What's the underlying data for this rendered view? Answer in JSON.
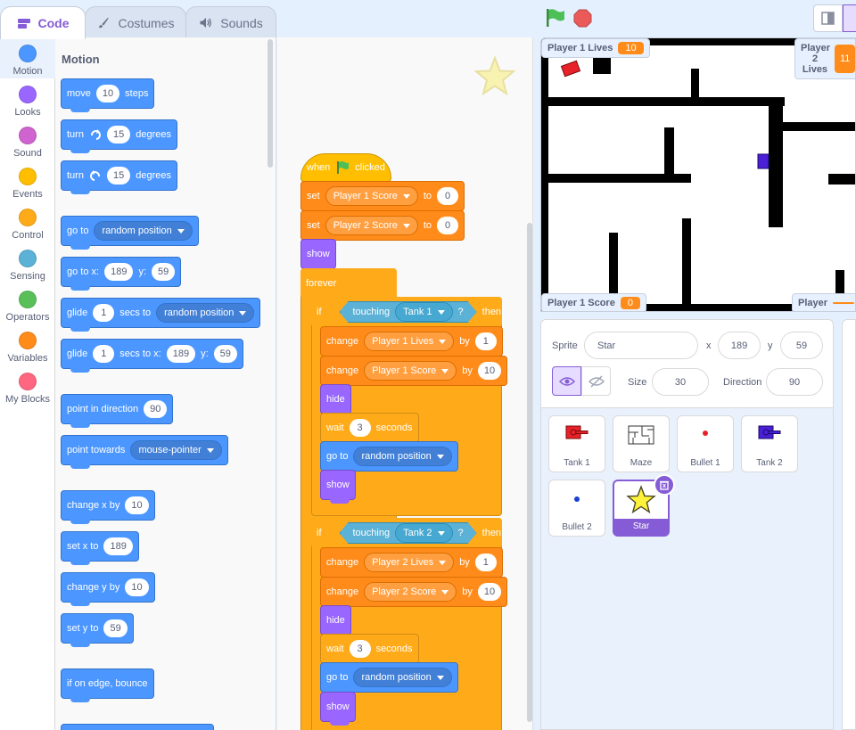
{
  "tabs": [
    {
      "label": "Code",
      "icon": "code-icon",
      "active": true
    },
    {
      "label": "Costumes",
      "icon": "brush-icon",
      "active": false
    },
    {
      "label": "Sounds",
      "icon": "speaker-icon",
      "active": false
    }
  ],
  "categories": [
    {
      "label": "Motion",
      "color": "#4c97ff"
    },
    {
      "label": "Looks",
      "color": "#9966ff"
    },
    {
      "label": "Sound",
      "color": "#cf63cf"
    },
    {
      "label": "Events",
      "color": "#ffbf00"
    },
    {
      "label": "Control",
      "color": "#ffab19"
    },
    {
      "label": "Sensing",
      "color": "#5cb1d6"
    },
    {
      "label": "Operators",
      "color": "#59c059"
    },
    {
      "label": "Variables",
      "color": "#ff8c1a"
    },
    {
      "label": "My Blocks",
      "color": "#ff6680"
    }
  ],
  "flyout": {
    "title": "Motion",
    "move": {
      "label": "move",
      "value": "10",
      "suffix": "steps"
    },
    "turn_right": {
      "label": "turn",
      "value": "15",
      "suffix": "degrees"
    },
    "turn_left": {
      "label": "turn",
      "value": "15",
      "suffix": "degrees"
    },
    "goto": {
      "label": "go to",
      "option": "random position"
    },
    "goto_xy": {
      "label": "go to x:",
      "x": "189",
      "ylabel": "y:",
      "y": "59"
    },
    "glide": {
      "label": "glide",
      "secs": "1",
      "mid": "secs to",
      "option": "random position"
    },
    "glide_xy": {
      "label": "glide",
      "secs": "1",
      "mid": "secs to x:",
      "x": "189",
      "ylabel": "y:",
      "y": "59"
    },
    "point_dir": {
      "label": "point in direction",
      "value": "90"
    },
    "point_towards": {
      "label": "point towards",
      "option": "mouse-pointer"
    },
    "change_x": {
      "label": "change x by",
      "value": "10"
    },
    "set_x": {
      "label": "set x to",
      "value": "189"
    },
    "change_y": {
      "label": "change y by",
      "value": "10"
    },
    "set_y": {
      "label": "set y to",
      "value": "59"
    },
    "bounce": {
      "label": "if on edge, bounce"
    }
  },
  "script": {
    "hat": {
      "when": "when",
      "clicked": "clicked"
    },
    "set1": {
      "label": "set",
      "var": "Player 1 Score",
      "to": "to",
      "value": "0"
    },
    "set2": {
      "label": "set",
      "var": "Player 2 Score",
      "to": "to",
      "value": "0"
    },
    "show": "show",
    "forever": "forever",
    "if1": {
      "if": "if",
      "touching": "touching",
      "target": "Tank 1",
      "q": "?",
      "then": "then"
    },
    "c1": {
      "label": "change",
      "var": "Player 1 Lives",
      "by": "by",
      "value": "1"
    },
    "c2": {
      "label": "change",
      "var": "Player 1 Score",
      "by": "by",
      "value": "10"
    },
    "hide": "hide",
    "wait": {
      "label": "wait",
      "value": "3",
      "suffix": "seconds"
    },
    "goto": {
      "label": "go to",
      "option": "random position"
    },
    "if2": {
      "if": "if",
      "touching": "touching",
      "target": "Tank 2",
      "q": "?",
      "then": "then"
    },
    "c3": {
      "label": "change",
      "var": "Player 2 Lives",
      "by": "by",
      "value": "1"
    },
    "c4": {
      "label": "change",
      "var": "Player 2 Score",
      "by": "by",
      "value": "10"
    }
  },
  "stage": {
    "monitors": {
      "p1_lives": {
        "label": "Player 1 Lives",
        "value": "10"
      },
      "p2_lives": {
        "label": "Player 2 Lives",
        "value": "11"
      },
      "p1_score": {
        "label": "Player 1 Score",
        "value": "0"
      },
      "p2_score": {
        "label": "Player",
        "value": ""
      }
    }
  },
  "sprite_info": {
    "sprite_label": "Sprite",
    "sprite_name": "Star",
    "x_label": "x",
    "x": "189",
    "y_label": "y",
    "y": "59",
    "size_label": "Size",
    "size": "30",
    "dir_label": "Direction",
    "direction": "90"
  },
  "sprites": [
    {
      "name": "Tank 1",
      "selected": false
    },
    {
      "name": "Maze",
      "selected": false
    },
    {
      "name": "Bullet 1",
      "selected": false
    },
    {
      "name": "Tank 2",
      "selected": false
    },
    {
      "name": "Bullet 2",
      "selected": false
    },
    {
      "name": "Star",
      "selected": true
    }
  ],
  "colors": {
    "accent": "#855cd6",
    "motion": "#4c97ff",
    "variables": "#ff8c1a",
    "control": "#ffab19",
    "looks": "#9966ff",
    "sensing": "#5cb1d6",
    "events": "#ffbf00"
  }
}
